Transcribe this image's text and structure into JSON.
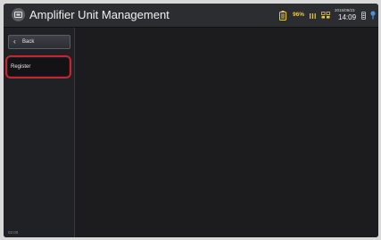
{
  "header": {
    "title": "Amplifier Unit Management",
    "battery_percent": "96%",
    "date": "2015/09/23",
    "time": "14:09"
  },
  "sidebar": {
    "back_label": "Back",
    "items": [
      {
        "label": "Register"
      }
    ],
    "footer_time": "02:00"
  },
  "colors": {
    "highlight": "#c8242c",
    "battery": "#e8c84a",
    "accent": "#4a8fe0"
  }
}
